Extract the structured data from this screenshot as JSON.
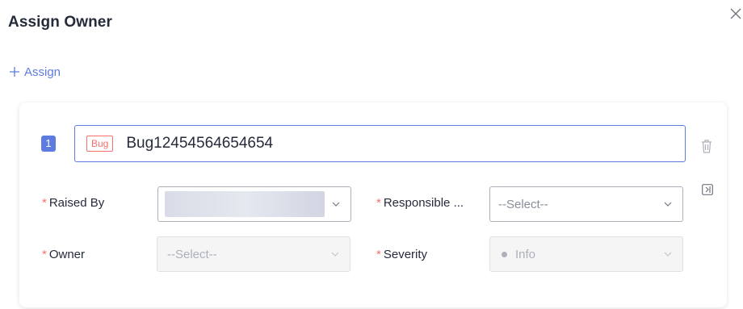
{
  "dialog": {
    "title": "Assign Owner",
    "close_icon": "close-icon"
  },
  "assign_link": {
    "icon": "plus-icon",
    "label": "Assign"
  },
  "card": {
    "index": "1",
    "work_item": {
      "type_tag": "Bug",
      "name": "Bug12454564654654"
    },
    "actions": {
      "delete_icon": "trash-icon",
      "side_panel_icon": "panel-icon"
    },
    "fields": {
      "raised_by": {
        "required": "*",
        "label": "Raised By",
        "value": ""
      },
      "responsible": {
        "required": "*",
        "label": "Responsible ...",
        "placeholder": "--Select--"
      },
      "owner": {
        "required": "*",
        "label": "Owner",
        "placeholder": "--Select--"
      },
      "severity": {
        "required": "*",
        "label": "Severity",
        "value": "Info"
      }
    }
  },
  "colors": {
    "accent": "#5e7ce0",
    "required": "#f66f6a",
    "bug_tag": "#f66f6a"
  }
}
